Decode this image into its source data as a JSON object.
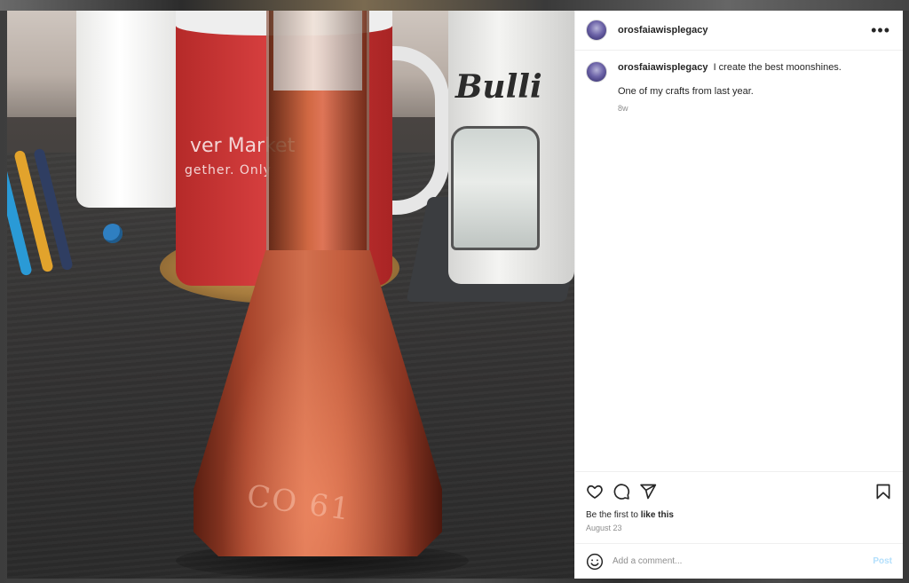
{
  "post": {
    "username": "orosfaiawisplegacy",
    "caption": {
      "username": "orosfaiawisplegacy",
      "text": "I create the best moonshines.",
      "line2": "One of my crafts from last year.",
      "age": "8w"
    },
    "likes": {
      "prefix": "Be the first to ",
      "action": "like this"
    },
    "date": "August 23"
  },
  "photo": {
    "mug_text_line1": "ver Market",
    "mug_text_line2": "gether. Only",
    "mug2_text": "Bulli",
    "bottle_emboss": "CO 61"
  },
  "comment": {
    "placeholder": "Add a comment...",
    "post_label": "Post"
  },
  "colors": {
    "accent": "#0095f6",
    "post_disabled": "#b2dffc",
    "text_primary": "#262626",
    "text_secondary": "#8e8e8e"
  },
  "icons": {
    "more": "more-horizontal-icon",
    "like": "heart-icon",
    "comment": "comment-icon",
    "share": "share-icon",
    "save": "bookmark-icon",
    "emoji": "emoji-icon"
  }
}
